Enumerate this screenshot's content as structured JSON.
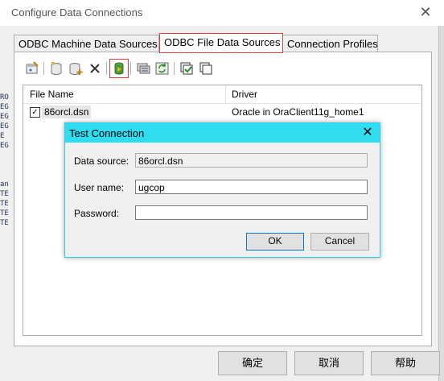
{
  "window": {
    "title": "Configure Data Connections",
    "close_glyph": "✕"
  },
  "tabs": [
    {
      "label": "ODBC Machine Data Sources"
    },
    {
      "label": "ODBC File Data Sources"
    },
    {
      "label": "Connection Profiles"
    }
  ],
  "list": {
    "headers": {
      "file_name": "File Name",
      "driver": "Driver"
    },
    "rows": [
      {
        "checked": true,
        "check_glyph": "✓",
        "file_name": "86orcl.dsn",
        "driver": "Oracle in OraClient11g_home1"
      }
    ]
  },
  "footer": {
    "ok_label": "确定",
    "cancel_label": "取消",
    "help_label": "帮助"
  },
  "test_dialog": {
    "title": "Test Connection",
    "close_glyph": "✕",
    "data_source_label": "Data source:",
    "data_source_value": "86orcl.dsn",
    "user_name_label": "User name:",
    "user_name_value": "ugcop",
    "password_label": "Password:",
    "password_value": "",
    "ok_label": "OK",
    "cancel_label": "Cancel"
  },
  "background_glyphs": [
    "RO",
    "EG",
    "EG",
    "EG",
    "E",
    "EG",
    "an",
    "TE",
    "TE",
    "TE",
    "TE"
  ],
  "colors": {
    "accent": "#2fdcf0",
    "highlight": "#e04040",
    "default_button": "#0078d7"
  }
}
